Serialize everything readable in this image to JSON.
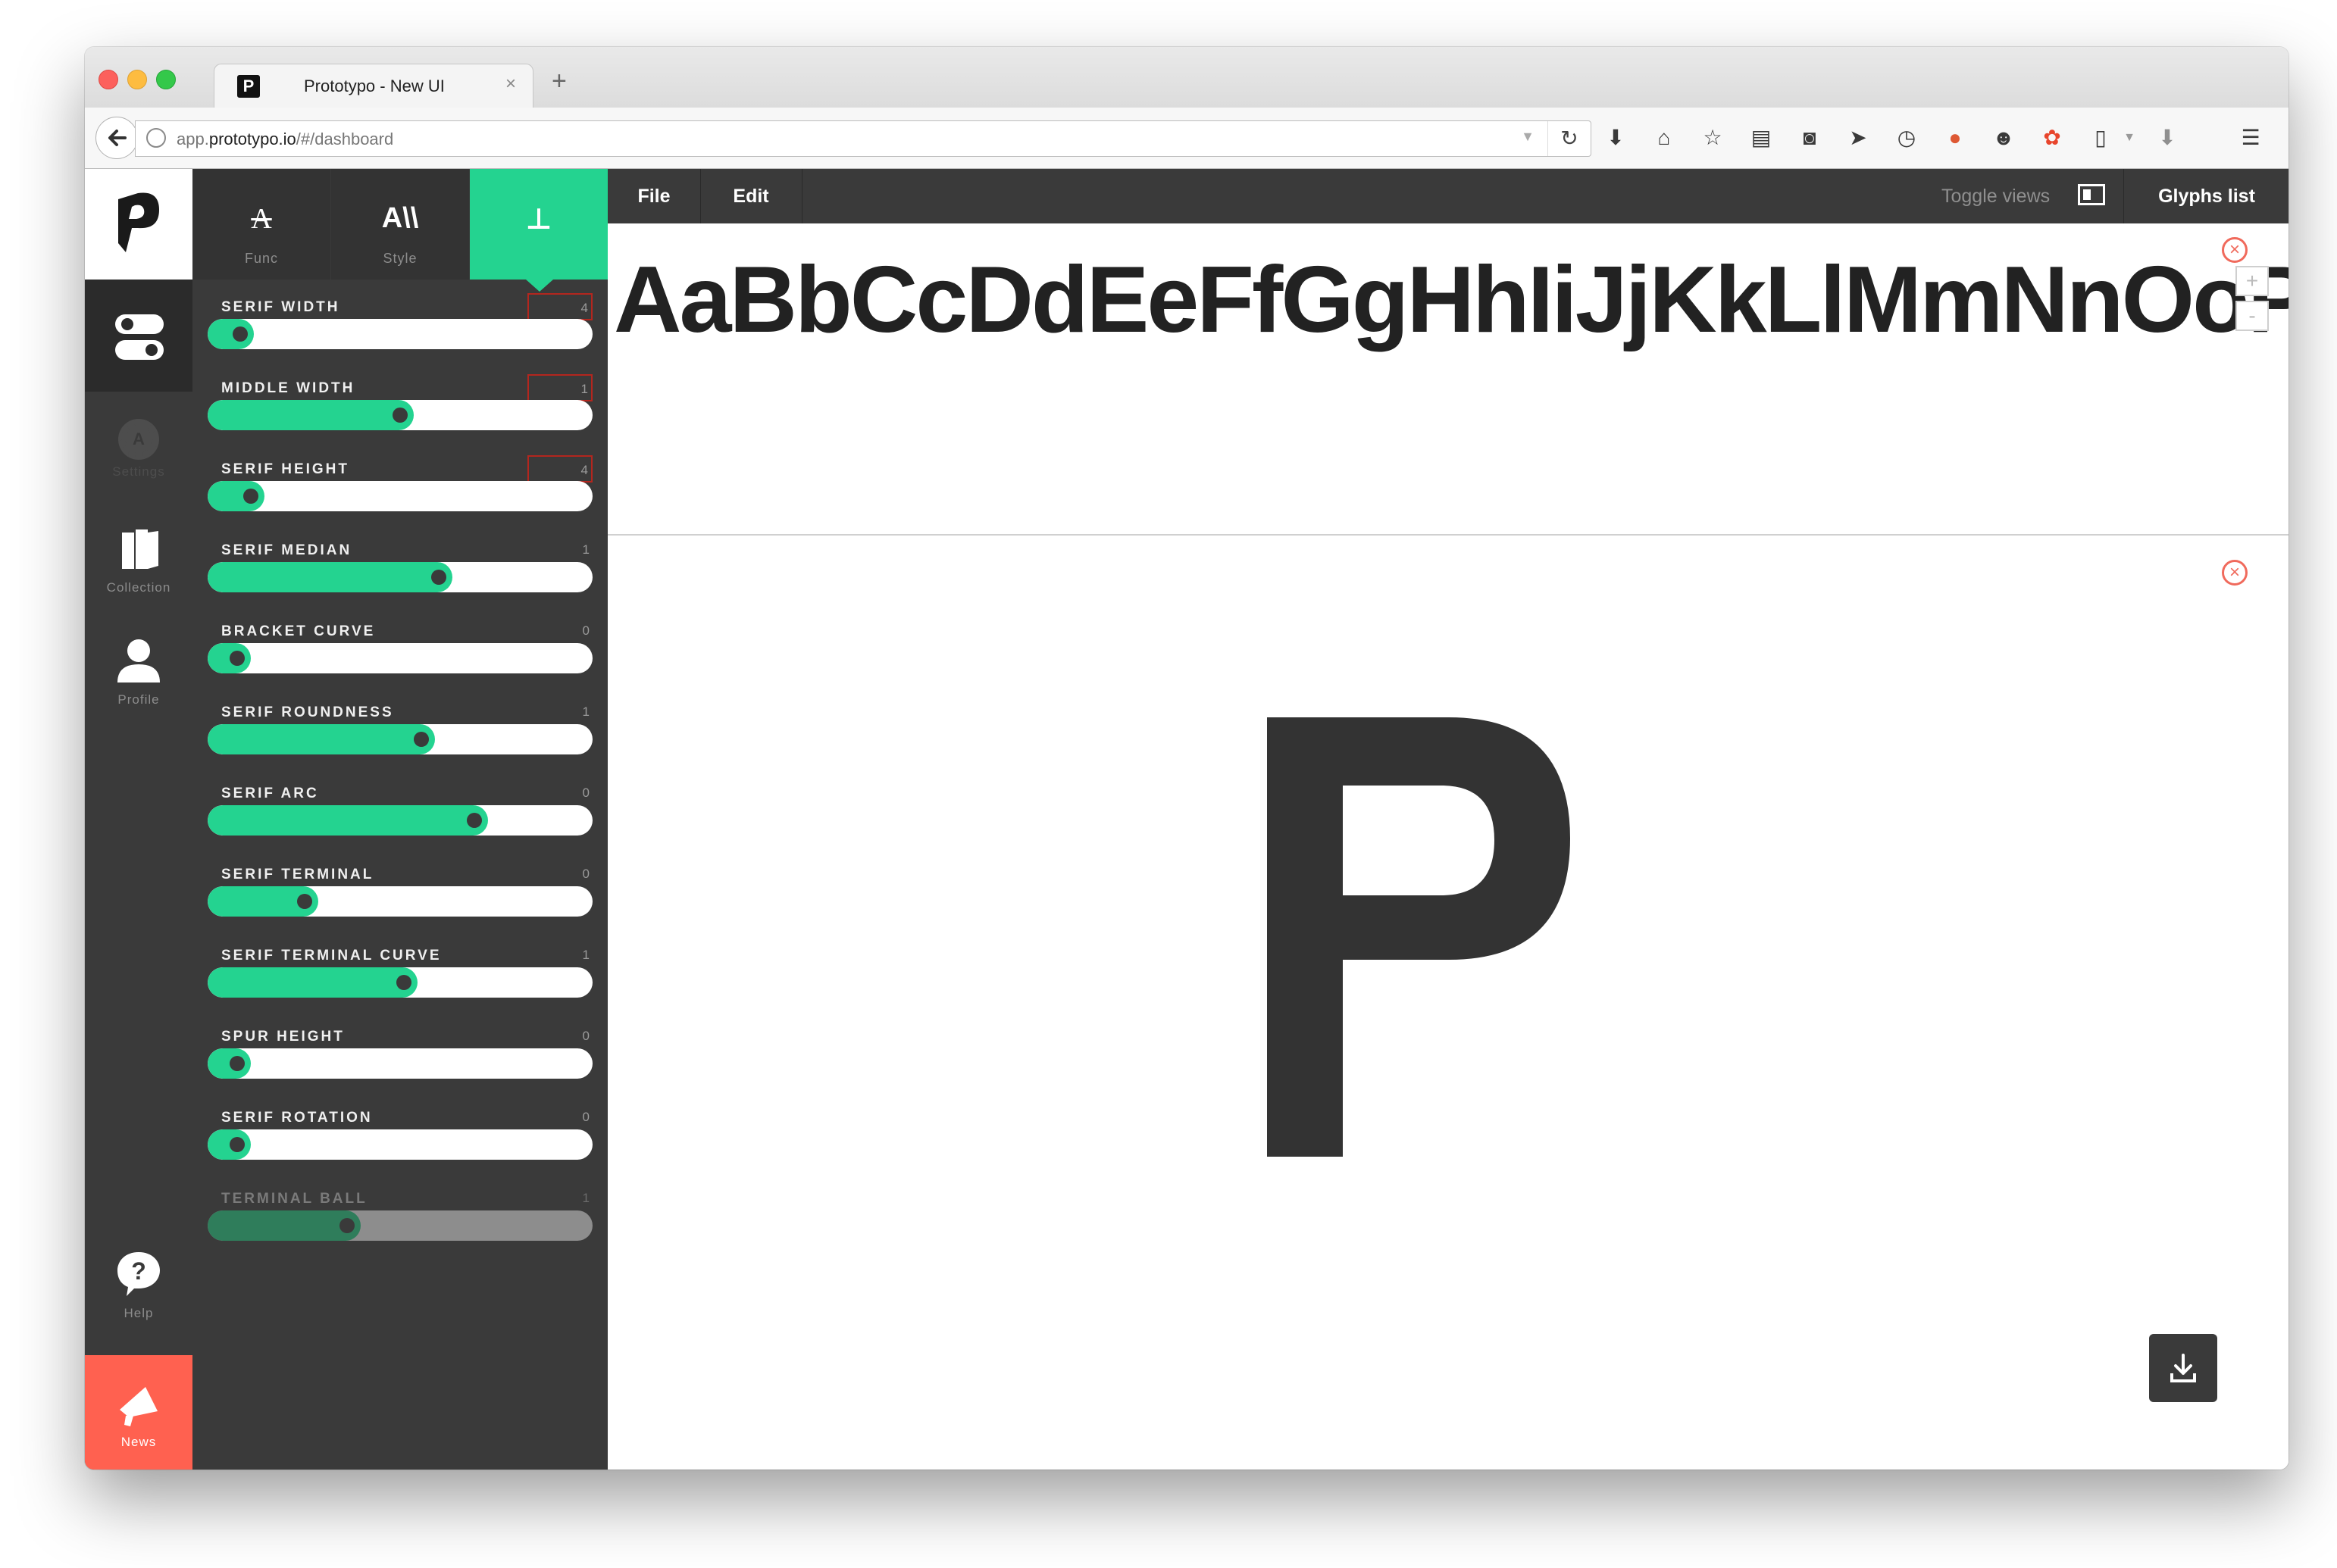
{
  "browser": {
    "tab_title": "Prototypo - New UI",
    "favicon_letter": "P",
    "tab_close": "×",
    "new_tab": "+",
    "url_prefix": "app.",
    "url_host": "prototypo.io",
    "url_path": "/#/dashboard"
  },
  "leftnav": {
    "items": [
      {
        "label": "Settings"
      },
      {
        "label": "Collection"
      },
      {
        "label": "Profile"
      },
      {
        "label": "Help"
      },
      {
        "label": "News"
      }
    ]
  },
  "param_tabs": [
    {
      "label": "Func",
      "glyph": "A"
    },
    {
      "label": "Style",
      "glyph": "A\\\\"
    },
    {
      "label": "",
      "glyph": "⊥"
    }
  ],
  "sliders": [
    {
      "label": "SERIF WIDTH",
      "value": "4",
      "fill": 0.05,
      "boxed": true,
      "disabled": false
    },
    {
      "label": "MIDDLE WIDTH",
      "value": "1",
      "fill": 0.5,
      "boxed": true,
      "disabled": false
    },
    {
      "label": "SERIF HEIGHT",
      "value": "4",
      "fill": 0.08,
      "boxed": true,
      "disabled": false
    },
    {
      "label": "SERIF MEDIAN",
      "value": "1",
      "fill": 0.61,
      "boxed": false,
      "disabled": false
    },
    {
      "label": "BRACKET CURVE",
      "value": "0",
      "fill": 0.04,
      "boxed": false,
      "disabled": false
    },
    {
      "label": "SERIF ROUNDNESS",
      "value": "1",
      "fill": 0.56,
      "boxed": false,
      "disabled": false
    },
    {
      "label": "SERIF ARC",
      "value": "0",
      "fill": 0.71,
      "boxed": false,
      "disabled": false
    },
    {
      "label": "SERIF TERMINAL",
      "value": "0",
      "fill": 0.23,
      "boxed": false,
      "disabled": false
    },
    {
      "label": "SERIF TERMINAL CURVE",
      "value": "1",
      "fill": 0.51,
      "boxed": false,
      "disabled": false
    },
    {
      "label": "SPUR HEIGHT",
      "value": "0",
      "fill": 0.04,
      "boxed": false,
      "disabled": false
    },
    {
      "label": "SERIF ROTATION",
      "value": "0",
      "fill": 0.04,
      "boxed": false,
      "disabled": false
    },
    {
      "label": "TERMINAL BALL",
      "value": "1",
      "fill": 0.35,
      "boxed": false,
      "disabled": true
    }
  ],
  "menu": {
    "file": "File",
    "edit": "Edit",
    "toggle_views": "Toggle views",
    "glyphs_list": "Glyphs list"
  },
  "text_view": {
    "sample": "AaBbCcDdEeFfGgHhIiJjKkLlMmNnOoP"
  },
  "glyph_view": {
    "glyph": "P"
  },
  "zoom": {
    "plus": "+",
    "minus": "-"
  },
  "colors": {
    "accent": "#24d390",
    "dark": "#3a3a3a",
    "news": "#ff6150",
    "close": "#f06a5c"
  }
}
